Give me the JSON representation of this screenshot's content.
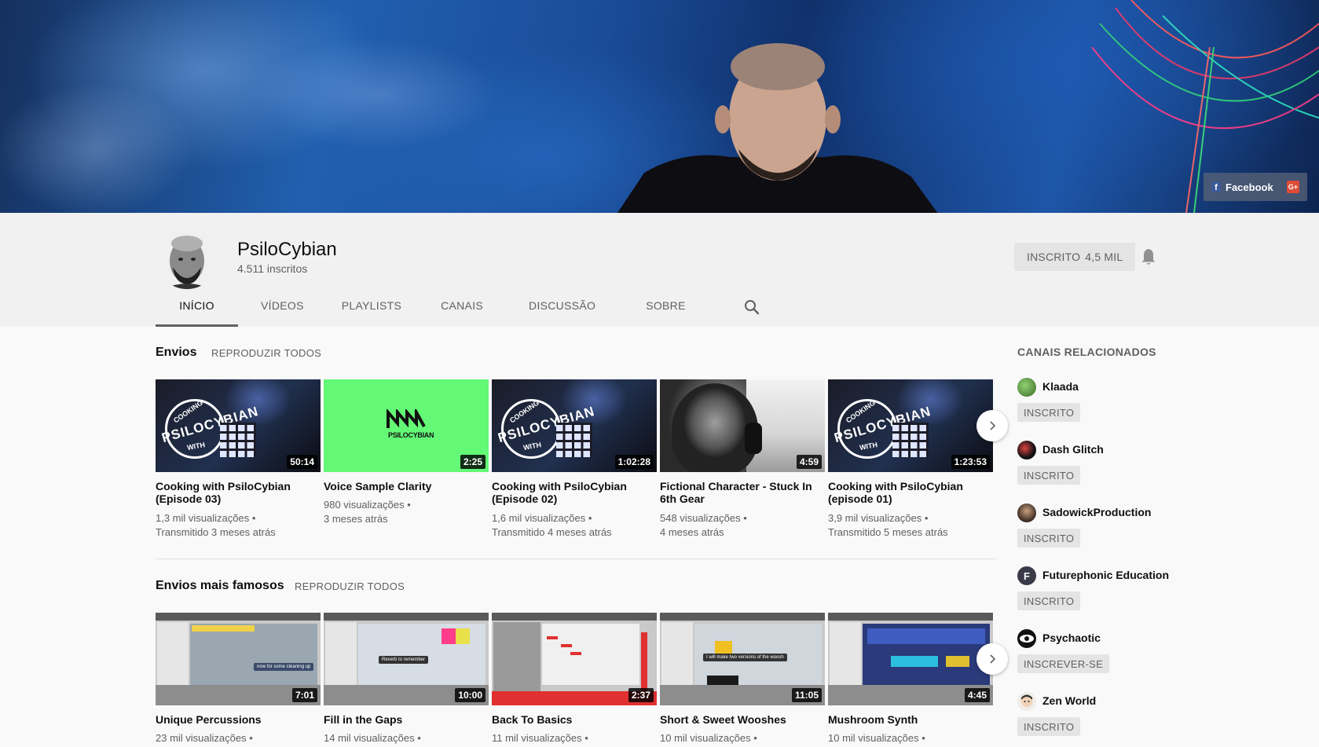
{
  "banner": {
    "links": {
      "facebook": "Facebook",
      "gplus": "G+"
    }
  },
  "channel": {
    "name": "PsiloCybian",
    "subscribers": "4.511 inscritos",
    "subscribe_label": "INSCRITO",
    "subscribe_count": "4,5 MIL"
  },
  "tabs": [
    "INÍCIO",
    "VÍDEOS",
    "PLAYLISTS",
    "CANAIS",
    "DISCUSSÃO",
    "SOBRE"
  ],
  "shelves": [
    {
      "title": "Envios",
      "play_all": "REPRODUZIR TODOS",
      "videos": [
        {
          "title": "Cooking with PsiloCybian (Episode 03)",
          "views": "1,3 mil visualizações •",
          "age": "Transmitido 3 meses atrás",
          "duration": "50:14"
        },
        {
          "title": "Voice Sample Clarity",
          "views": "980 visualizações •",
          "age": "3 meses atrás",
          "duration": "2:25",
          "logo": "PSILOCYBIAN"
        },
        {
          "title": "Cooking with PsiloCybian (Episode 02)",
          "views": "1,6 mil visualizações •",
          "age": "Transmitido 4 meses atrás",
          "duration": "1:02:28"
        },
        {
          "title": "Fictional Character - Stuck In 6th Gear",
          "views": "548 visualizações •",
          "age": "4 meses atrás",
          "duration": "4:59"
        },
        {
          "title": "Cooking with PsiloCybian (episode 01)",
          "views": "3,9 mil visualizações •",
          "age": "Transmitido 5 meses atrás",
          "duration": "1:23:53"
        }
      ],
      "thumb_text": {
        "stamp": "PSILOCYBIAN",
        "top": "COOKING",
        "bottom": "WITH"
      }
    },
    {
      "title": "Envios mais famosos",
      "play_all": "REPRODUZIR TODOS",
      "videos": [
        {
          "title": "Unique Percussions",
          "views": "23 mil visualizações •",
          "duration": "7:01",
          "tip": "now for some cleaning up"
        },
        {
          "title": "Fill in the Gaps",
          "views": "14 mil visualizações •",
          "duration": "10:00",
          "tip": "Reverb to remember"
        },
        {
          "title": "Back To Basics",
          "views": "11 mil visualizações •",
          "duration": "2:37"
        },
        {
          "title": "Short & Sweet Wooshes",
          "views": "10 mil visualizações •",
          "duration": "11:05",
          "tip": "I will make two versions of the woosh"
        },
        {
          "title": "Mushroom Synth",
          "views": "10 mil visualizações •",
          "duration": "4:45"
        }
      ]
    }
  ],
  "related": {
    "title": "CANAIS RELACIONADOS",
    "channels": [
      {
        "name": "Klaada",
        "button": "INSCRITO",
        "color": "#4e8a3a"
      },
      {
        "name": "Dash Glitch",
        "button": "INSCRITO",
        "color": "#1a1a1a"
      },
      {
        "name": "SadowickProduction",
        "button": "INSCRITO",
        "color": "#5a4030"
      },
      {
        "name": "Futurephonic Education",
        "button": "INSCRITO",
        "color": "#3a3a48"
      },
      {
        "name": "Psychaotic",
        "button": "INSCREVER-SE",
        "color": "#111111"
      },
      {
        "name": "Zen World",
        "button": "INSCRITO",
        "color": "#e8e0d8"
      }
    ]
  }
}
